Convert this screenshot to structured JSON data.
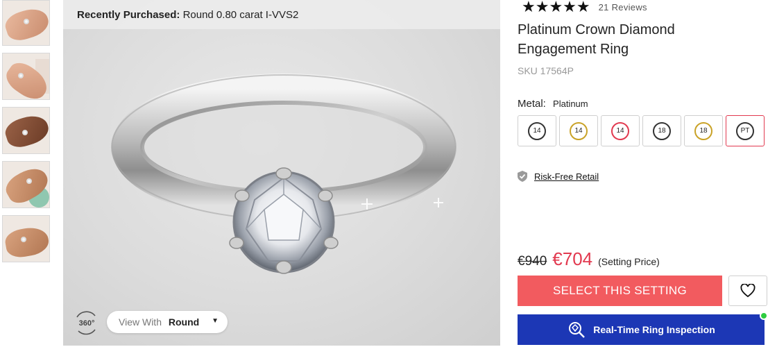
{
  "recent": {
    "label": "Recently Purchased:",
    "value": "Round 0.80 carat I-VVS2"
  },
  "viewer": {
    "rotate_label": "360°",
    "view_with_label": "View With",
    "view_with_value": "Round"
  },
  "product": {
    "stars": "★★★★★",
    "reviews": "21 Reviews",
    "title": "Platinum Crown Diamond Engagement Ring",
    "sku": "SKU 17564P"
  },
  "metal": {
    "label": "Metal:",
    "value": "Platinum",
    "options": [
      {
        "text": "14",
        "color": "#333333",
        "selected": false
      },
      {
        "text": "14",
        "color": "#c9a227",
        "selected": false
      },
      {
        "text": "14",
        "color": "#e2394f",
        "selected": false
      },
      {
        "text": "18",
        "color": "#333333",
        "selected": false
      },
      {
        "text": "18",
        "color": "#c9a227",
        "selected": false
      },
      {
        "text": "PT",
        "color": "#333333",
        "selected": true
      }
    ]
  },
  "risk": {
    "label": "Risk-Free Retail"
  },
  "price": {
    "old": "€940",
    "new": "€704",
    "note": "(Setting Price)"
  },
  "actions": {
    "select_label": "SELECT THIS SETTING",
    "inspection_label": "Real-Time Ring Inspection"
  },
  "colors": {
    "accent": "#f25b5f",
    "price_red": "#e2394f",
    "inspection_blue": "#1c37b5",
    "online_green": "#2ecc40"
  }
}
